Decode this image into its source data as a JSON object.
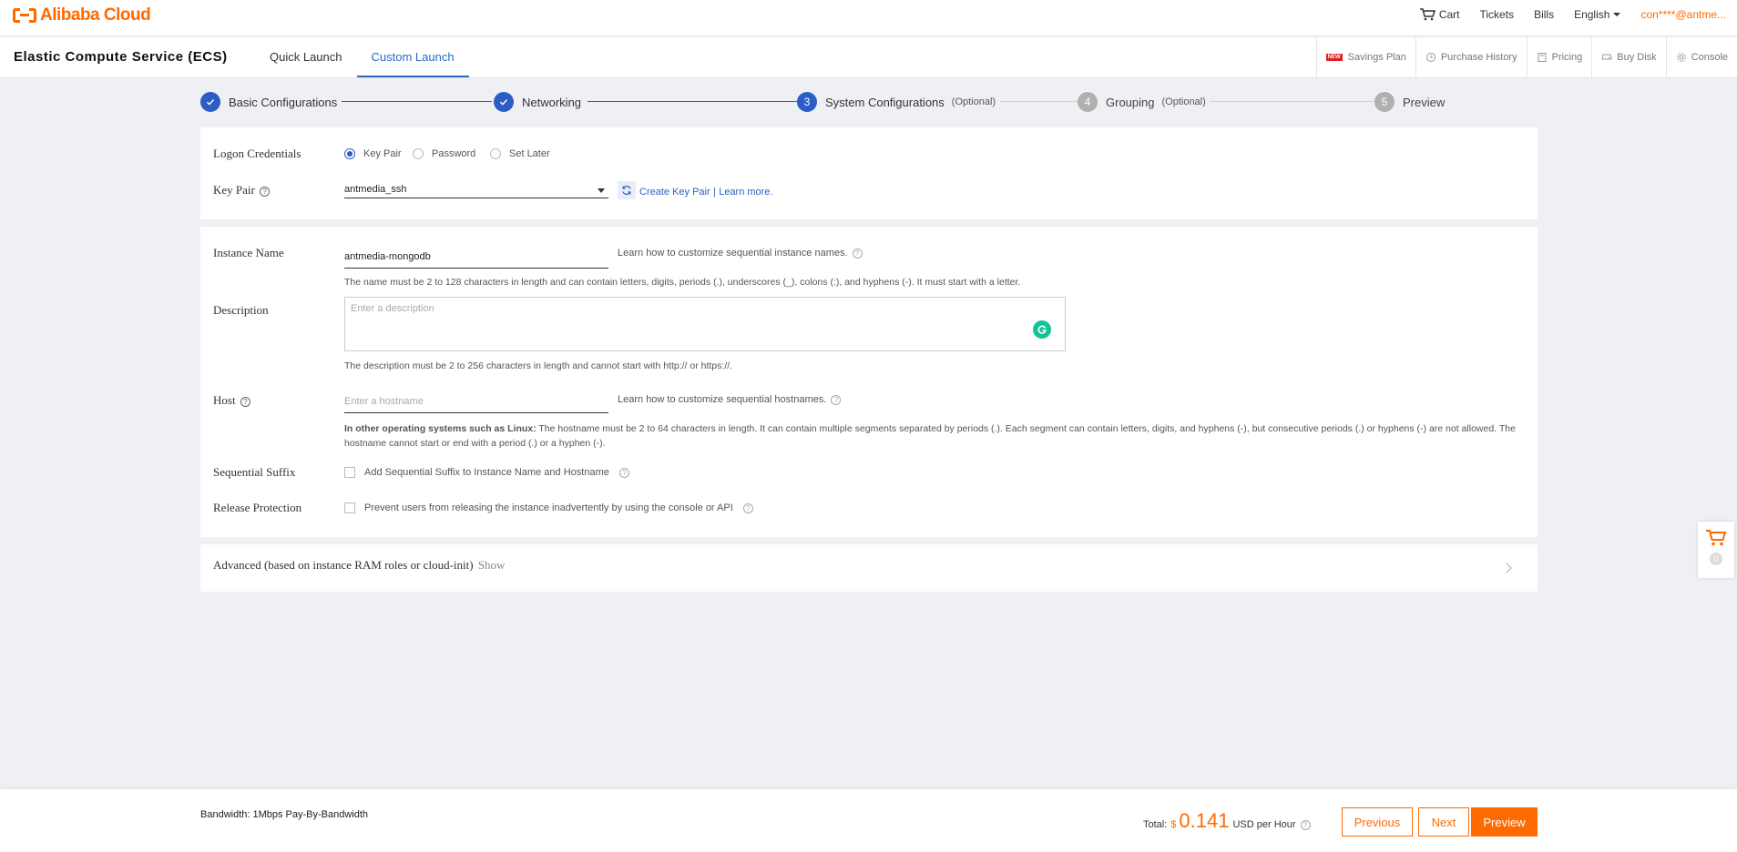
{
  "brand": {
    "name": "Alibaba Cloud",
    "color": "#ff6a00"
  },
  "topnav": {
    "cart": "Cart",
    "tickets": "Tickets",
    "bills": "Bills",
    "language": "English",
    "account": "con****@antme..."
  },
  "subhead": {
    "product": "Elastic Compute Service (ECS)",
    "tabs": [
      "Quick Launch",
      "Custom Launch"
    ],
    "active_tab": "Custom Launch",
    "links": {
      "new_badge": "NEW",
      "savings_plan": "Savings Plan",
      "purchase_history": "Purchase History",
      "pricing": "Pricing",
      "buy_disk": "Buy Disk",
      "console": "Console"
    }
  },
  "steps": [
    {
      "label": "Basic Configurations",
      "number": "",
      "optional": "",
      "state": "done"
    },
    {
      "label": "Networking",
      "number": "",
      "optional": "",
      "state": "done"
    },
    {
      "label": "System Configurations",
      "number": "3",
      "optional": "(Optional)",
      "state": "current"
    },
    {
      "label": "Grouping",
      "number": "4",
      "optional": "(Optional)",
      "state": "todo"
    },
    {
      "label": "Preview",
      "number": "5",
      "optional": "",
      "state": "todo"
    }
  ],
  "logon": {
    "label": "Logon Credentials",
    "options": [
      "Key Pair",
      "Password",
      "Set Later"
    ],
    "selected": "Key Pair"
  },
  "key_pair": {
    "label": "Key Pair",
    "value": "antmedia_ssh",
    "create_link": "Create Key Pair",
    "separator": "|",
    "learn_link": "Learn more."
  },
  "instance_name": {
    "label": "Instance Name",
    "value": "antmedia-mongodb",
    "hint": "Learn how to customize sequential instance names.",
    "note": "The name must be 2 to 128 characters in length and can contain letters, digits, periods (.), underscores (_), colons (:), and hyphens (-). It must start with a letter."
  },
  "description": {
    "label": "Description",
    "placeholder": "Enter a description",
    "note": "The description must be 2 to 256 characters in length and cannot start with http:// or https://."
  },
  "host": {
    "label": "Host",
    "placeholder": "Enter a hostname",
    "hint": "Learn how to customize sequential hostnames.",
    "note_bold": "In other operating systems such as Linux:",
    "note": " The hostname must be 2 to 64 characters in length. It can contain multiple segments separated by periods (.). Each segment can contain letters, digits, and hyphens (-), but consecutive periods (.) or hyphens (-) are not allowed. The hostname cannot start or end with a period (.) or a hyphen (-)."
  },
  "sequential_suffix": {
    "label": "Sequential Suffix",
    "checkbox": "Add Sequential Suffix to Instance Name and Hostname",
    "checked": false
  },
  "release_protection": {
    "label": "Release Protection",
    "checkbox": "Prevent users from releasing the instance inadvertently by using the console or API",
    "checked": false
  },
  "advanced": {
    "label": "Advanced (based on instance RAM roles or cloud-init)",
    "toggle": "Show"
  },
  "float_cart": {
    "count": "0"
  },
  "footer": {
    "bandwidth": "Bandwidth: 1Mbps Pay-By-Bandwidth",
    "total_label": "Total:",
    "currency": "$",
    "amount": "0.141",
    "unit": "USD per Hour",
    "buttons": {
      "previous": "Previous",
      "next": "Next",
      "preview": "Preview"
    }
  }
}
